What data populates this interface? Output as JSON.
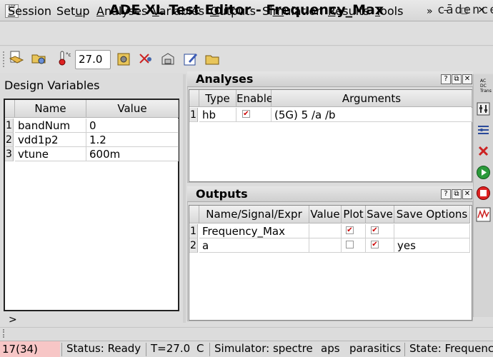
{
  "window": {
    "title": "ADE XL Test Editor - Frequency_Max",
    "app_icon_text": "ADE GLI",
    "buttons": {
      "minimize": "–",
      "maximize": "□",
      "close": "✕"
    }
  },
  "menubar": {
    "items": [
      {
        "label": "Session",
        "mnemonic": "S",
        "rest": "ession"
      },
      {
        "label": "Setup",
        "lead": "Set",
        "mnemonic": "u",
        "rest": "p"
      },
      {
        "label": "Analyses",
        "mnemonic": "A",
        "rest": "nalyses"
      },
      {
        "label": "Variables",
        "mnemonic": "V",
        "rest": "ariables"
      },
      {
        "label": "Outputs",
        "mnemonic": "O",
        "rest": "utputs"
      },
      {
        "label": "Simulation",
        "lead": "Si",
        "mnemonic": "m",
        "rest": "ulation"
      },
      {
        "label": "Results",
        "mnemonic": "R",
        "rest": "esults"
      },
      {
        "label": "Tools",
        "mnemonic": "T",
        "rest": "ools"
      }
    ],
    "overflow": "»",
    "brand": "cādence"
  },
  "toolbar": {
    "temperature": "27.0",
    "icons": [
      "open-session-icon",
      "load-state-icon",
      "thermometer-icon",
      "cut-icon",
      "variables-icon",
      "save-state-icon",
      "edit-icon",
      "folder-icon"
    ]
  },
  "design_variables": {
    "label": "Design Variables",
    "columns": [
      "Name",
      "Value"
    ],
    "rows": [
      {
        "num": "1",
        "name": "bandNum",
        "value": "0"
      },
      {
        "num": "2",
        "name": "vdd1p2",
        "value": "1.2"
      },
      {
        "num": "3",
        "name": "vtune",
        "value": "600m"
      }
    ],
    "prompt": ">"
  },
  "analyses": {
    "title": "Analyses",
    "columns": [
      "Type",
      "Enable",
      "Arguments"
    ],
    "rows": [
      {
        "num": "1",
        "type": "hb",
        "enabled": true,
        "arguments": "(5G) 5 /a /b"
      }
    ]
  },
  "outputs": {
    "title": "Outputs",
    "columns": [
      "Name/Signal/Expr",
      "Value",
      "Plot",
      "Save",
      "Save Options"
    ],
    "rows": [
      {
        "num": "1",
        "name": "Frequency_Max",
        "value": "",
        "plot": true,
        "save": true,
        "save_options": ""
      },
      {
        "num": "2",
        "name": "a",
        "value": "",
        "plot": false,
        "save": true,
        "save_options": "yes"
      }
    ]
  },
  "dock_buttons": {
    "help": "?",
    "float": "⧉",
    "close": "✕"
  },
  "side_toolbar": {
    "analysis_options": [
      "AC",
      "DC",
      "Trans"
    ],
    "icons": [
      "analysis-choice-icon",
      "tuning-icon",
      "netlist-icon",
      "stop-icon",
      "run-icon",
      "cancel-icon",
      "plot-icon"
    ]
  },
  "status": {
    "count": "17(34)",
    "status": "Status: Ready",
    "temp": "T=27.0",
    "c": "C",
    "simulator": "Simulator: spectre",
    "aps": "aps",
    "parasitics": "parasitics",
    "state": "State: Frequenc"
  },
  "colors": {
    "check": "#cc0000",
    "status_highlight": "#f7c6c6"
  }
}
